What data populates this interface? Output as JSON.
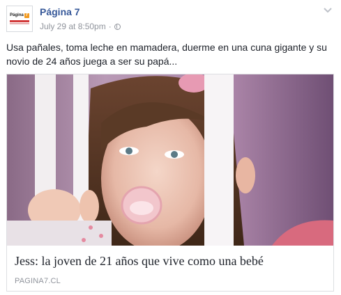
{
  "post": {
    "page_name": "Página 7",
    "timestamp": "July 29 at 8:50pm",
    "separator": "·",
    "privacy_icon": "globe-icon",
    "menu_icon": "chevron-down-icon",
    "text": "Usa pañales, toma leche en mamadera, duerme en una cuna gigante y su novio de 24 años juega a ser su papá..."
  },
  "avatar": {
    "logo_text": "Página",
    "logo_badge": "7"
  },
  "link_card": {
    "title": "Jess: la joven de 21 años que vive como una bebé",
    "domain": "PAGINA7.CL"
  },
  "colors": {
    "page_name": "#365899",
    "meta_text": "#90949c",
    "body_text": "#1d2129",
    "card_border": "#dddfe2",
    "logo_badge": "#f29a1f"
  }
}
